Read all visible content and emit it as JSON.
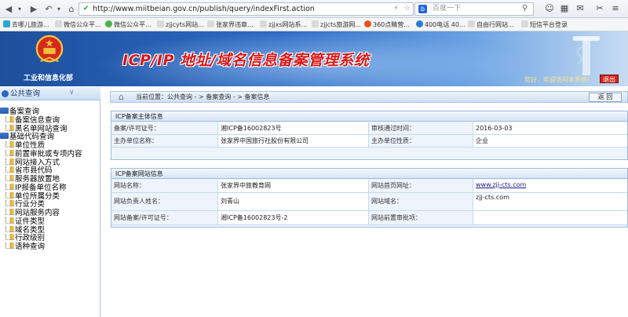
{
  "browser": {
    "url": "http://www.miitbeian.gov.cn/publish/query/indexFirst.action",
    "search_placeholder": "百度一下",
    "bookmarks": [
      "去哪儿旅游...",
      "微信公众平...",
      "微信公众平...",
      "zjjcyts网站...",
      "张家界违章...",
      "zjjxs网站系...",
      "zjjcts旅游网...",
      "360点睛营...",
      "400电话 40...",
      "自由行网站...",
      "短信平台登录"
    ]
  },
  "header": {
    "ministry": "工业和信息化部",
    "title": "ICP/IP 地址/域名信息备案管理系统",
    "welcome": "您好，欢迎访问本系统！",
    "logout": "退出"
  },
  "sidebar": {
    "title": "公共查询",
    "items": [
      {
        "label": "备案查询",
        "level": 0
      },
      {
        "label": "备案信息查询",
        "level": 1
      },
      {
        "label": "黑名单网站查询",
        "level": 1
      },
      {
        "label": "基础代码查询",
        "level": 0
      },
      {
        "label": "单位性质",
        "level": 1
      },
      {
        "label": "前置审批或专项内容",
        "level": 1
      },
      {
        "label": "网站接入方式",
        "level": 1
      },
      {
        "label": "省市县代码",
        "level": 1
      },
      {
        "label": "服务器放置地",
        "level": 1
      },
      {
        "label": "IP报备单位名称",
        "level": 1
      },
      {
        "label": "单位所属分类",
        "level": 1
      },
      {
        "label": "行业分类",
        "level": 1
      },
      {
        "label": "网站服务内容",
        "level": 1
      },
      {
        "label": "证件类型",
        "level": 1
      },
      {
        "label": "域名类型",
        "level": 1
      },
      {
        "label": "行政级别",
        "level": 1
      },
      {
        "label": "语种查询",
        "level": 1
      }
    ]
  },
  "breadcrumb": {
    "text": "当前位置：公共查询  - >  备案查询  - >  备案信息",
    "back_button": "返 回"
  },
  "sponsor_panel": {
    "title": "ICP备案主体信息",
    "fields": {
      "license_label": "备案/许可证号：",
      "license_value": "湘ICP备16002823号",
      "approved_label": "审核通过时间：",
      "approved_value": "2016-03-03",
      "org_label": "主办单位名称：",
      "org_value": "张家界中国旅行社股份有限公司",
      "nature_label": "主办单位性质：",
      "nature_value": "企业"
    }
  },
  "site_panel": {
    "title": "ICP备案网站信息",
    "fields": {
      "name_label": "网站名称：",
      "name_value": "张家界中旅教育网",
      "home_label": "网站首页网址：",
      "home_value": "www.zjj-cts.com",
      "owner_label": "网站负责人姓名：",
      "owner_value": "刘青山",
      "domain_label": "网站域名：",
      "domain_value": "zjj-cts.com",
      "license_label": "网站备案/许可证号：",
      "license_value": "湘ICP备16002823号-2",
      "preapproval_label": "网站前置审批项：",
      "preapproval_value": ""
    }
  },
  "colors": {
    "header_blue": "#2d6bc4",
    "title_red": "#d91818",
    "panel_border": "#9dbbe3"
  }
}
